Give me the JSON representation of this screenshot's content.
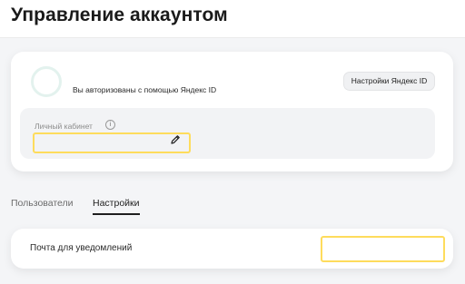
{
  "header": {
    "title": "Управление аккаунтом"
  },
  "account": {
    "auth_text": "Вы авторизованы с помощью Яндекс ID",
    "settings_button": "Настройки Яндекс ID",
    "cabinet_label": "Личный кабинет",
    "cabinet_value": "",
    "info_icon": "info-icon",
    "edit_icon": "pencil-icon"
  },
  "tabs": [
    {
      "label": "Пользователи",
      "active": false
    },
    {
      "label": "Настройки",
      "active": true
    }
  ],
  "notifications": {
    "label": "Почта для уведомлений",
    "value": ""
  },
  "colors": {
    "accent_highlight": "#fedc5c",
    "avatar_ring": "#e3f2ee",
    "page_background": "#f4f5f7"
  }
}
